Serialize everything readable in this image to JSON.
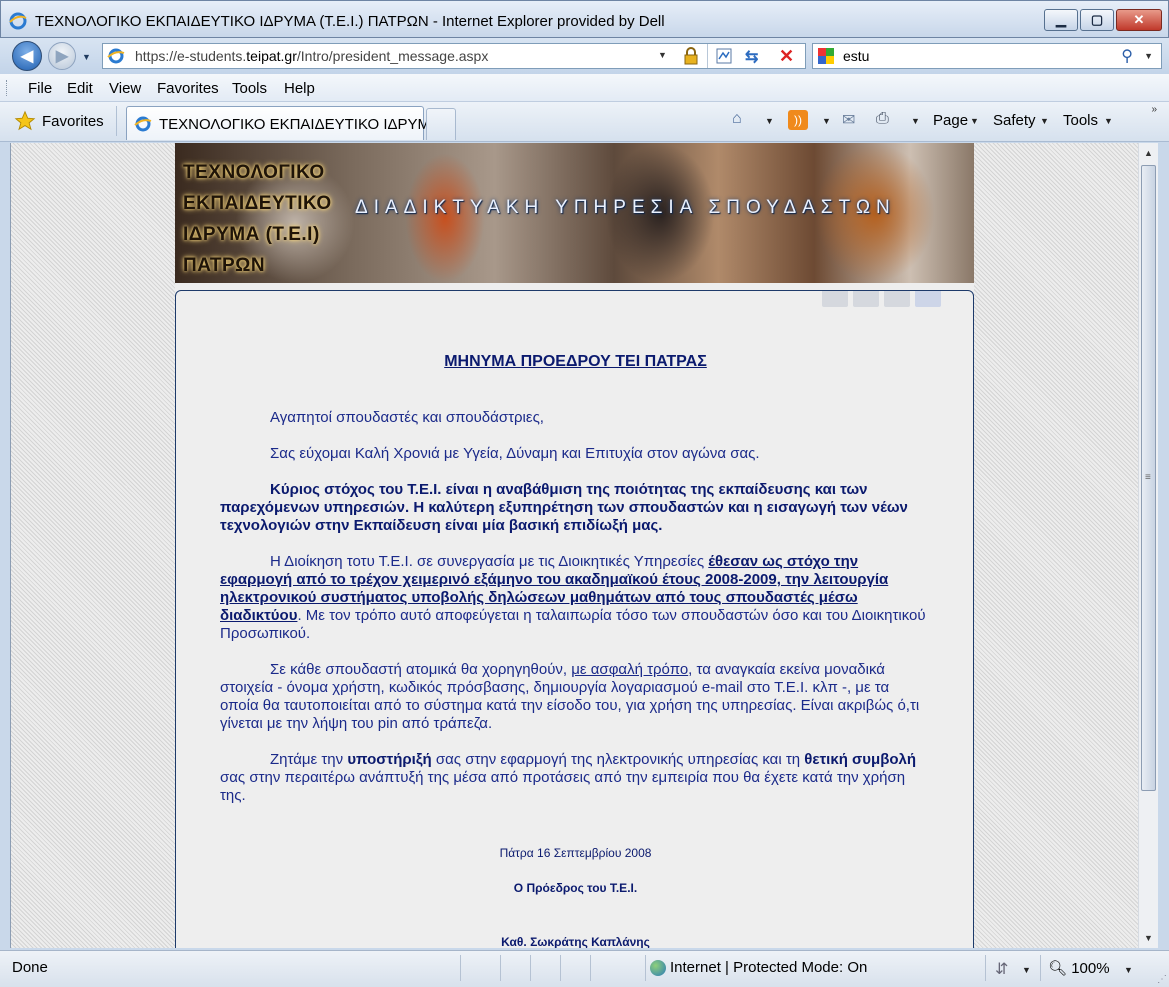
{
  "window": {
    "title": "ΤΕΧΝΟΛΟΓΙΚΟ ΕΚΠΑΙΔΕΥΤΙΚΟ ΙΔΡΥΜΑ (Τ.Ε.Ι.) ΠΑΤΡΩΝ - Internet Explorer provided by Dell"
  },
  "address": {
    "url_prefix": "https://e-students.",
    "url_domain": "teipat.gr",
    "url_path": "/Intro/president_message.aspx"
  },
  "search": {
    "query": "estu"
  },
  "menu": {
    "items": [
      "File",
      "Edit",
      "View",
      "Favorites",
      "Tools",
      "Help"
    ]
  },
  "commandbar": {
    "favorites_label": "Favorites",
    "tab_label": "ΤΕΧΝΟΛΟΓΙΚΟ ΕΚΠΑΙΔΕΥΤΙΚΟ ΙΔΡΥΜ...",
    "page_label": "Page",
    "safety_label": "Safety",
    "tools_label": "Tools"
  },
  "banner": {
    "inst_line1": "ΤΕΧΝΟΛΟΓΙΚΟ",
    "inst_line2": "ΕΚΠΑΙΔΕΥΤΙΚΟ",
    "inst_line3": "ΙΔΡΥΜΑ (Τ.Ε.Ι)",
    "inst_line4": "ΠΑΤΡΩΝ",
    "service": "ΔΙΑΔΙΚΤΥΑΚΗ ΥΠΗΡΕΣΙΑ ΣΠΟΥΔΑΣΤΩΝ"
  },
  "message": {
    "title": "ΜΗΝΥΜΑ ΠΡΟΕΔΡΟΥ ΤΕΙ ΠΑΤΡΑΣ",
    "p1": "Αγαπητοί σπουδαστές και σπουδάστριες,",
    "p2": "Σας εύχομαι Καλή Χρονιά με Υγεία, Δύναμη και Επιτυχία στον αγώνα σας.",
    "p3": "Κύριος στόχος του Τ.Ε.Ι. είναι η αναβάθμιση της ποιότητας της εκπαίδευσης και των παρεχόμενων υπηρεσιών. Η καλύτερη εξυπηρέτηση των σπουδαστών και η εισαγωγή των νέων τεχνολογιών στην Εκπαίδευση είναι μία βασική επιδίωξή μας.",
    "p4_a": "Η Διοίκηση τοτυ Τ.Ε.Ι. σε συνεργασία με τις Διοικητικές Υπηρεσίες ",
    "p4_b": "έθεσαν ως στόχο την εφαρμογή από το τρέχον χειμερινό εξάμηνο του ακαδημαϊκού έτους 2008-2009, την λειτουργία ηλεκτρονικού συστήματος υποβολής δηλώσεων μαθημάτων από τους σπουδαστές μέσω διαδικτύου",
    "p4_c": ". Με τον τρόπο αυτό αποφεύγεται η ταλαιπωρία τόσο των σπουδαστών όσο και του Διοικητικού Προσωπικού.",
    "p5_a": "Σε κάθε σπουδαστή ατομικά θα χορηγηθούν, ",
    "p5_b": "με ασφαλή τρόπο",
    "p5_c": ", τα αναγκαία εκείνα μοναδικά στοιχεία - όνομα χρήστη, κωδικός πρόσβασης, δημιουργία λογαριασμού e-mail στο Τ.Ε.Ι. κλπ -, με τα οποία θα ταυτοποιείται από το σύστημα κατά την είσοδο του, για χρήση της υπηρεσίας. Είναι ακριβώς ό,τι γίνεται με την λήψη του pin από τράπεζα.",
    "p6_a": "Ζητάμε την ",
    "p6_b": "υποστήριξή",
    "p6_c": " σας στην εφαρμογή της ηλεκτρονικής υπηρεσίας και τη ",
    "p6_d": "θετική συμβολή",
    "p6_e": " σας στην περαιτέρω ανάπτυξή της μέσα από προτάσεις από την εμπειρία που θα έχετε κατά την χρήση της.",
    "date": "Πάτρα 16 Σεπτεμβρίου 2008",
    "role": "Ο Πρόεδρος του Τ.Ε.Ι.",
    "name": "Καθ. Σωκράτης Καπλάνης"
  },
  "status": {
    "text": "Done",
    "zone": "Internet | Protected Mode: On",
    "zoom": "100%"
  },
  "icons": {
    "back": "back-arrow-icon",
    "forward": "forward-arrow-icon",
    "lock": "lock-icon",
    "refresh": "refresh-icon",
    "stop": "stop-icon",
    "search": "search-icon",
    "favorites": "star-icon",
    "home": "home-icon",
    "feeds": "rss-icon",
    "mail": "mail-icon",
    "print": "print-icon"
  },
  "colors": {
    "link_text": "#0b1a6e",
    "body_text": "#1b2a8a"
  }
}
